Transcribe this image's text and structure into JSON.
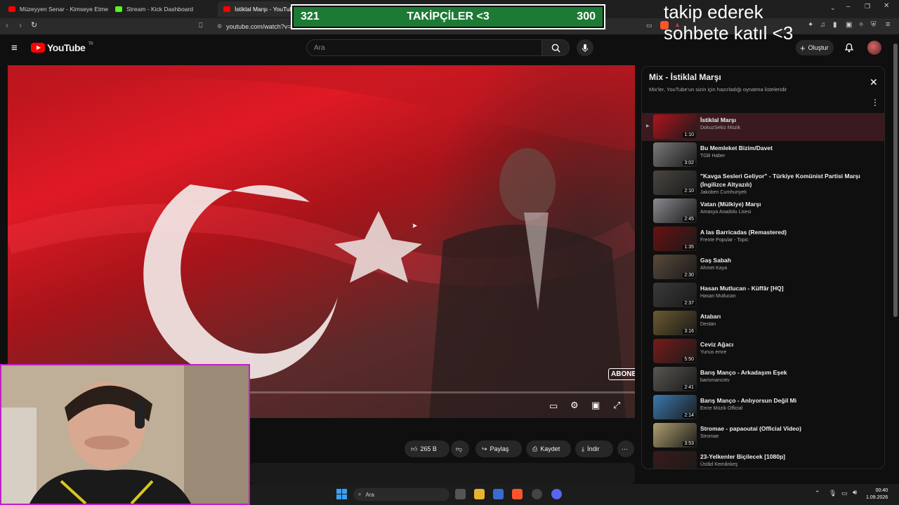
{
  "browser": {
    "tabs": [
      {
        "label": "Müzeyyen Senar - Kimseye Etme"
      },
      {
        "label": "Stream - Kick Dashboard"
      },
      {
        "label": "İstiklal Marşı - YouTube"
      }
    ],
    "url": "youtube.com/watch?v="
  },
  "overlay": {
    "left_count": "321",
    "title": "TAKİPÇİLER <3",
    "right_count": "300",
    "chat_line1": "takip ederek",
    "chat_line2": "sohbete katıl <3"
  },
  "header": {
    "logo_text": "YouTube",
    "logo_region": "TR",
    "search_placeholder": "Ara",
    "create_label": "Oluştur"
  },
  "video": {
    "watermark": "ABONE"
  },
  "actions": {
    "likes": "265 B",
    "share": "Paylaş",
    "save": "Kaydet",
    "download": "İndir"
  },
  "mix": {
    "title": "Mix - İstiklal Marşı",
    "subtitle": "Mix'ler, YouTube'un sizin için hazırladığı oynatma listeleridir",
    "items": [
      {
        "title": "İstiklal Marşı",
        "channel": "DokuzSekiz Müzik",
        "duration": "1:10",
        "color": "#b0141c"
      },
      {
        "title": "Bu Memleket Bizim/Davet",
        "channel": "TGB Haber",
        "duration": "3:02",
        "color": "#7a7a7a"
      },
      {
        "title": "\"Kavga Sesleri Geliyor\" - Türkiye Komünist Partisi Marşı (İngilizce Altyazılı)",
        "channel": "Jakoben Cumhuriyeti",
        "duration": "2:10",
        "color": "#4a4640"
      },
      {
        "title": "Vatan (Mülkiye) Marşı",
        "channel": "Amasya Anadolu Lisesi",
        "duration": "2:45",
        "color": "#8a8a90"
      },
      {
        "title": "A las Barricadas (Remastered)",
        "channel": "Frente Popular - Topic",
        "duration": "1:35",
        "color": "#6a1010"
      },
      {
        "title": "Gaş Sabah",
        "channel": "Ahmet Kaya",
        "duration": "2:30",
        "color": "#5a4a3a"
      },
      {
        "title": "Hasan Mutlucan - Küffâr [HQ]",
        "channel": "Hasan Mutlucan",
        "duration": "2:37",
        "color": "#3a3a3a"
      },
      {
        "title": "Atabarı",
        "channel": "Destan",
        "duration": "3:16",
        "color": "#6a5a30"
      },
      {
        "title": "Ceviz Ağacı",
        "channel": "Yunus emre",
        "duration": "5:50",
        "color": "#7a1a1a"
      },
      {
        "title": "Barış Manço - Arkadaşım Eşek",
        "channel": "barismancotv",
        "duration": "2:41",
        "color": "#5a5650"
      },
      {
        "title": "Barış Manço - Anlıyorsun Değil Mi",
        "channel": "Emre Müzik Official",
        "duration": "2:14",
        "color": "#3a7ab0"
      },
      {
        "title": "Stromae - papaoutai (Official Video)",
        "channel": "Stromae",
        "duration": "3:53",
        "color": "#b0a070"
      },
      {
        "title": "23-Yelkenler Biçilecek [1080p]",
        "channel": "Üstâd Kemânkeş",
        "duration": "",
        "color": "#3a1a1a"
      }
    ]
  },
  "taskbar": {
    "search_placeholder": "Ara",
    "time": "00:40",
    "date": "1.09.2026"
  }
}
